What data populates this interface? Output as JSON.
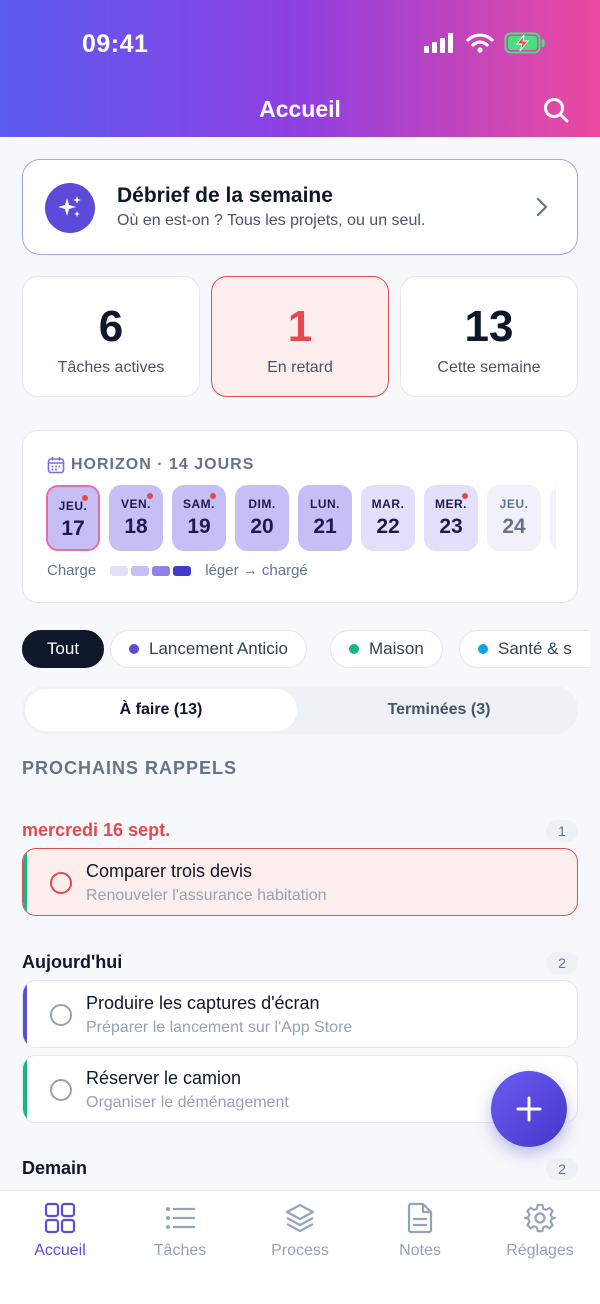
{
  "status": {
    "time": "09:41"
  },
  "header": {
    "title": "Accueil"
  },
  "debrief": {
    "title": "Débrief de la semaine",
    "subtitle": "Où en est-on ? Tous les projets, ou un seul."
  },
  "stats": [
    {
      "value": "6",
      "label": "Tâches actives"
    },
    {
      "value": "1",
      "label": "En retard"
    },
    {
      "value": "13",
      "label": "Cette semaine"
    }
  ],
  "horizon": {
    "title": "HORIZON · 14 JOURS",
    "days": [
      {
        "name": "JEU.",
        "num": "17",
        "dot": true
      },
      {
        "name": "VEN.",
        "num": "18",
        "dot": true
      },
      {
        "name": "SAM.",
        "num": "19",
        "dot": true
      },
      {
        "name": "DIM.",
        "num": "20",
        "dot": false
      },
      {
        "name": "LUN.",
        "num": "21",
        "dot": false
      },
      {
        "name": "MAR.",
        "num": "22",
        "dot": false
      },
      {
        "name": "MER.",
        "num": "23",
        "dot": true
      },
      {
        "name": "JEU.",
        "num": "24",
        "dot": false
      }
    ],
    "legend_label": "Charge",
    "legend_range": "léger → chargé"
  },
  "filters": [
    {
      "label": "Tout",
      "color": ""
    },
    {
      "label": "Lancement Anticio",
      "color": "#5b4bd8"
    },
    {
      "label": "Maison",
      "color": "#10b981"
    },
    {
      "label": "Santé & s",
      "color": "#0ea5e9"
    }
  ],
  "segment": {
    "todo": "À faire (13)",
    "done": "Terminées (3)"
  },
  "section_title": "PROCHAINS RAPPELS",
  "groups": [
    {
      "label": "mercredi 16 sept.",
      "count": "1"
    },
    {
      "label": "Aujourd'hui",
      "count": "2"
    },
    {
      "label": "Demain",
      "count": "2"
    }
  ],
  "tasks": [
    {
      "title": "Comparer trois devis",
      "subtitle": "Renouveler l'assurance habitation",
      "accent": "#10b981"
    },
    {
      "title": "Produire les captures d'écran",
      "subtitle": "Préparer le lancement sur l'App Store",
      "accent": "#5b4bd8"
    },
    {
      "title": "Réserver le camion",
      "subtitle": "Organiser le déménagement",
      "accent": "#10b981"
    }
  ],
  "tabs": [
    {
      "label": "Accueil",
      "icon": "grid-icon"
    },
    {
      "label": "Tâches",
      "icon": "list-icon"
    },
    {
      "label": "Process",
      "icon": "layers-icon"
    },
    {
      "label": "Notes",
      "icon": "document-icon"
    },
    {
      "label": "Réglages",
      "icon": "gear-icon"
    }
  ],
  "colors": {
    "accent": "#5b4bd8",
    "danger": "#e5484d",
    "success": "#10b981"
  }
}
